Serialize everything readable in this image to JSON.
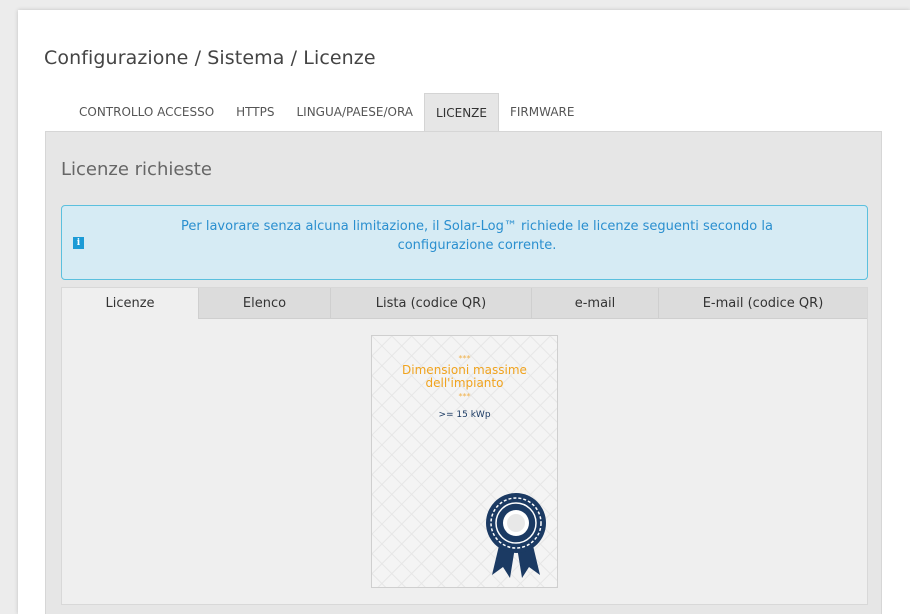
{
  "breadcrumb": "Configurazione / Sistema / Licenze",
  "top_tabs": [
    {
      "label": "CONTROLLO ACCESSO"
    },
    {
      "label": "HTTPS"
    },
    {
      "label": "LINGUA/PAESE/ORA"
    },
    {
      "label": "LICENZE",
      "active": true
    },
    {
      "label": "FIRMWARE"
    }
  ],
  "section_title": "Licenze richieste",
  "info": {
    "icon": "info-icon",
    "text": "Per lavorare senza alcuna limitazione, il Solar-Log™ richiede le licenze seguenti secondo la configurazione corrente."
  },
  "sub_tabs": [
    {
      "label": "Licenze",
      "active": true
    },
    {
      "label": "Elenco"
    },
    {
      "label": "Lista (codice QR)"
    },
    {
      "label": "e-mail"
    },
    {
      "label": "E-mail (codice QR)"
    }
  ],
  "license_card": {
    "stars_top": "***",
    "title": "Dimensioni massime dell'impianto",
    "stars_bottom": "***",
    "value": ">= 15 kWp",
    "badge_icon": "award-rosette-icon"
  },
  "colors": {
    "accent_blue": "#1c9bd6",
    "info_bg": "#d6ebf4",
    "info_border": "#5bc0de",
    "license_orange": "#f0a31e",
    "rosette_navy": "#1b3a63"
  }
}
